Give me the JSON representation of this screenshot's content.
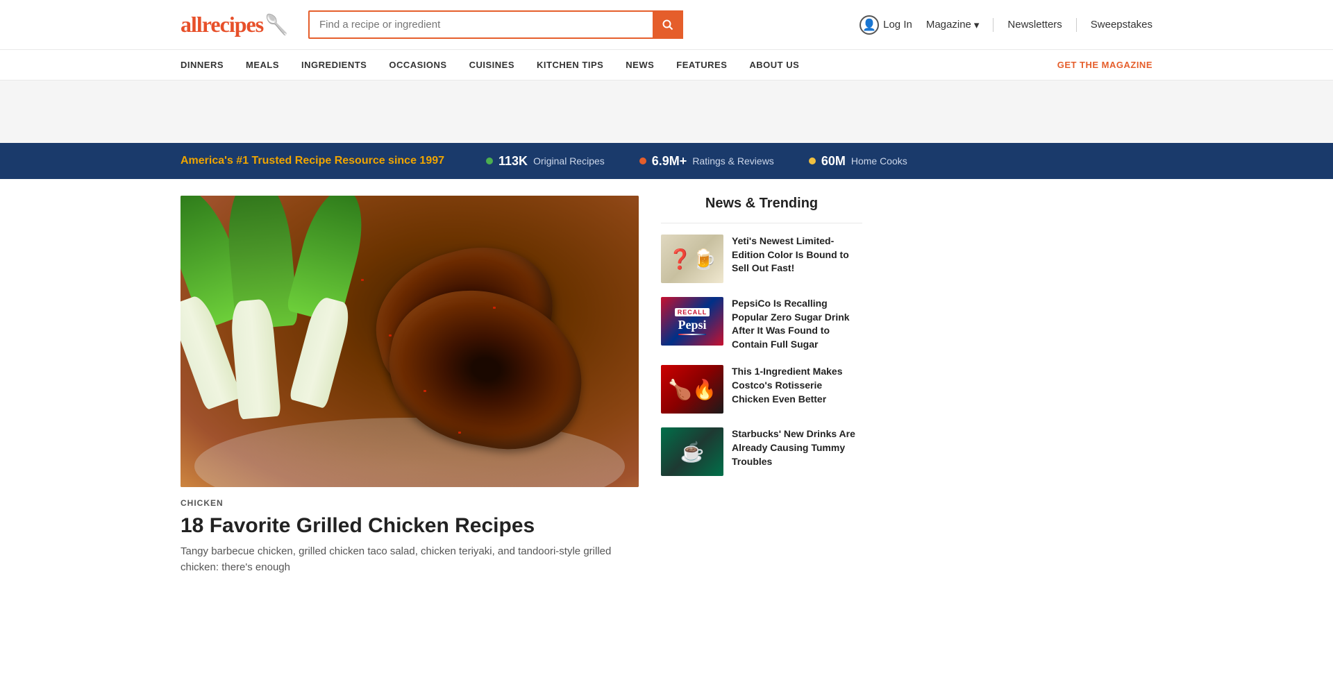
{
  "header": {
    "logo": "allrecipes",
    "logo_spoon": "!",
    "search_placeholder": "Find a recipe or ingredient",
    "login_label": "Log In",
    "magazine_label": "Magazine",
    "newsletters_label": "Newsletters",
    "sweepstakes_label": "Sweepstakes"
  },
  "nav": {
    "items": [
      {
        "label": "DINNERS"
      },
      {
        "label": "MEALS"
      },
      {
        "label": "INGREDIENTS"
      },
      {
        "label": "OCCASIONS"
      },
      {
        "label": "CUISINES"
      },
      {
        "label": "KITCHEN TIPS"
      },
      {
        "label": "NEWS"
      },
      {
        "label": "FEATURES"
      },
      {
        "label": "ABOUT US"
      }
    ],
    "cta": "GET THE MAGAZINE"
  },
  "stats_bar": {
    "tagline_start": "America's ",
    "tagline_highlight": "#1 Trusted Recipe Resource",
    "tagline_end": " since 1997",
    "stats": [
      {
        "dot_color": "#4caf50",
        "number": "113K",
        "label": "Original Recipes"
      },
      {
        "dot_color": "#e55e2b",
        "number": "6.9M+",
        "label": "Ratings & Reviews"
      },
      {
        "dot_color": "#f0c040",
        "number": "60M",
        "label": "Home Cooks"
      }
    ]
  },
  "hero": {
    "category": "CHICKEN",
    "title": "18 Favorite Grilled Chicken Recipes",
    "description": "Tangy barbecue chicken, grilled chicken taco salad, chicken teriyaki, and tandoori-style grilled chicken: there's enough"
  },
  "sidebar": {
    "title": "News & Trending",
    "items": [
      {
        "id": "yeti",
        "thumbnail_type": "yeti",
        "thumbnail_emoji": "❓",
        "text": "Yeti's Newest Limited-Edition Color Is Bound to Sell Out Fast!"
      },
      {
        "id": "pepsi",
        "thumbnail_type": "pepsi",
        "thumbnail_label": "RECALL\nPEPSI",
        "text": "PepsiCo Is Recalling Popular Zero Sugar Drink After It Was Found to Contain Full Sugar"
      },
      {
        "id": "costco",
        "thumbnail_type": "costco",
        "thumbnail_emoji": "🍗",
        "text": "This 1-Ingredient Makes Costco's Rotisserie Chicken Even Better"
      },
      {
        "id": "starbucks",
        "thumbnail_type": "starbucks",
        "thumbnail_emoji": "☕",
        "text": "Starbucks' New Drinks Are Already Causing Tummy Troubles"
      }
    ]
  }
}
